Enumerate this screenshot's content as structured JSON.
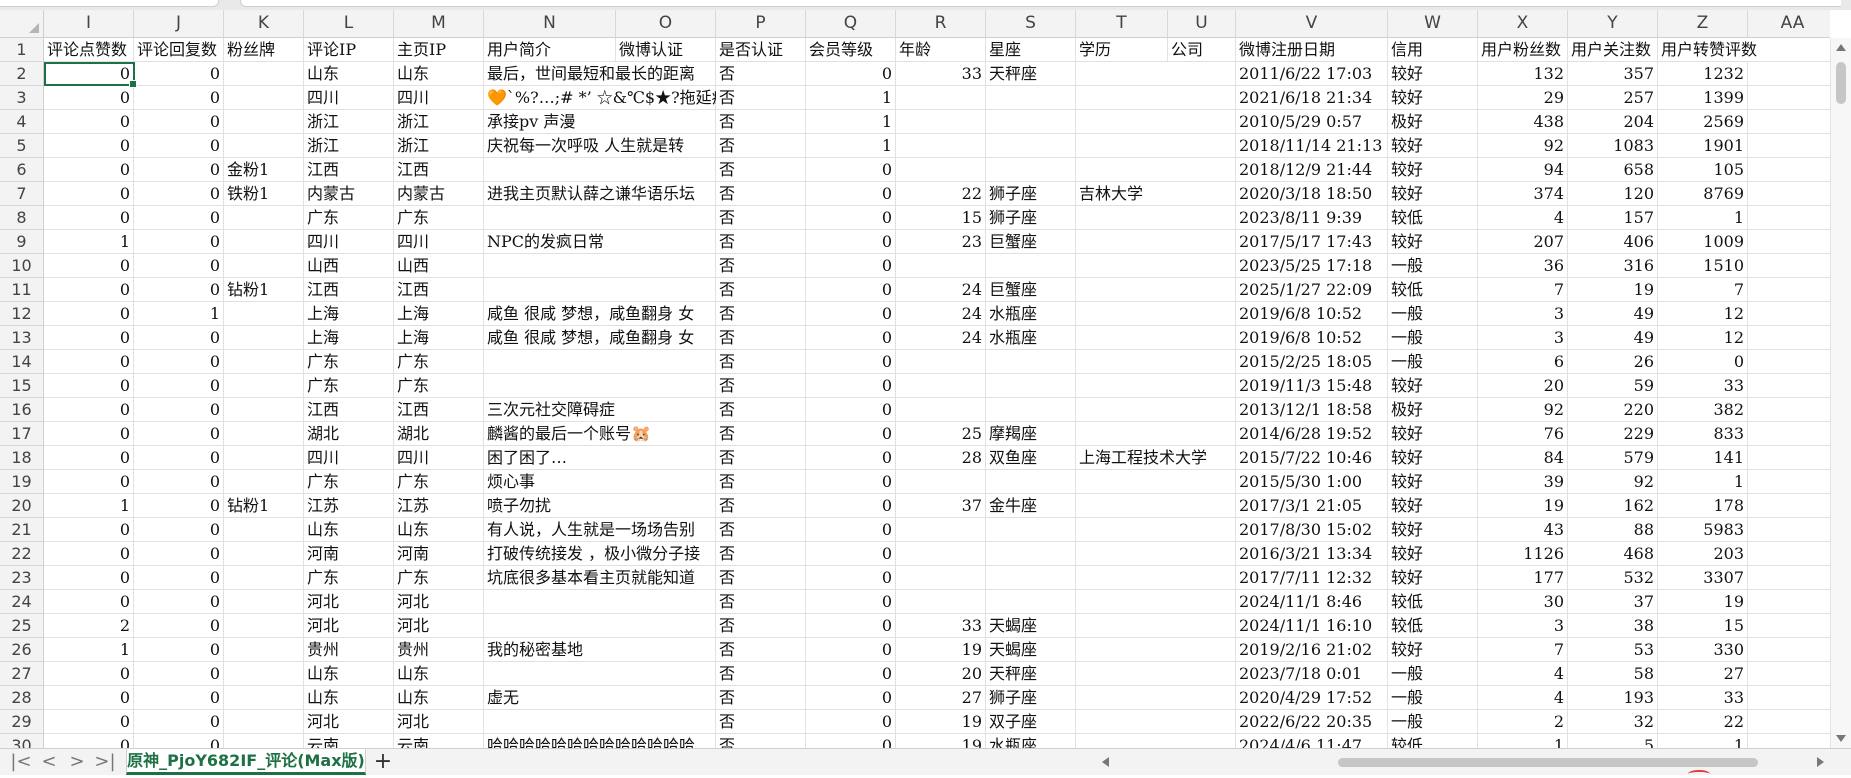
{
  "columns": [
    "I",
    "J",
    "K",
    "L",
    "M",
    "N",
    "O",
    "P",
    "Q",
    "R",
    "S",
    "T",
    "U",
    "V",
    "W",
    "X",
    "Y",
    "Z",
    "AA"
  ],
  "row_numbers": [
    1,
    2,
    3,
    4,
    5,
    6,
    7,
    8,
    9,
    10,
    11,
    12,
    13,
    14,
    15,
    16,
    17,
    18,
    19,
    20,
    21,
    22,
    23,
    24,
    25,
    26,
    27,
    28,
    29,
    30
  ],
  "header_row": [
    "评论点赞数",
    "评论回复数",
    "粉丝牌",
    "评论IP",
    "主页IP",
    "用户简介",
    "微博认证",
    "是否认证",
    "会员等级",
    "年龄",
    "星座",
    "学历",
    "公司",
    "微博注册日期",
    "信用",
    "用户粉丝数",
    "用户关注数",
    "用户转赞评数",
    ""
  ],
  "rows": [
    [
      "0",
      "0",
      "",
      "山东",
      "山东",
      "最后，世间最短和最长的距离",
      "",
      "否",
      "0",
      "33",
      "天秤座",
      "",
      "",
      "2011/6/22 17:03",
      "较好",
      "132",
      "357",
      "1232",
      ""
    ],
    [
      "0",
      "0",
      "",
      "四川",
      "四川",
      "🧡`%?…;# *’ ☆&℃$★?拖延症",
      "",
      "否",
      "1",
      "",
      "",
      "",
      "",
      "2021/6/18 21:34",
      "较好",
      "29",
      "257",
      "1399",
      ""
    ],
    [
      "0",
      "0",
      "",
      "浙江",
      "浙江",
      "承接pv 声漫",
      "",
      "否",
      "1",
      "",
      "",
      "",
      "",
      "2010/5/29 0:57",
      "极好",
      "438",
      "204",
      "2569",
      ""
    ],
    [
      "0",
      "0",
      "",
      "浙江",
      "浙江",
      "庆祝每一次呼吸 人生就是转",
      "",
      "否",
      "1",
      "",
      "",
      "",
      "",
      "2018/11/14 21:13",
      "较好",
      "92",
      "1083",
      "1901",
      ""
    ],
    [
      "0",
      "0",
      "金粉1",
      "江西",
      "江西",
      "",
      "",
      "否",
      "0",
      "",
      "",
      "",
      "",
      "2018/12/9 21:44",
      "较好",
      "94",
      "658",
      "105",
      ""
    ],
    [
      "0",
      "0",
      "铁粉1",
      "内蒙古",
      "内蒙古",
      "进我主页默认薛之谦华语乐坛",
      "",
      "否",
      "0",
      "22",
      "狮子座",
      "吉林大学",
      "",
      "2020/3/18 18:50",
      "较好",
      "374",
      "120",
      "8769",
      ""
    ],
    [
      "0",
      "0",
      "",
      "广东",
      "广东",
      "",
      "",
      "否",
      "0",
      "15",
      "狮子座",
      "",
      "",
      "2023/8/11 9:39",
      "较低",
      "4",
      "157",
      "1",
      ""
    ],
    [
      "1",
      "0",
      "",
      "四川",
      "四川",
      "NPC的发疯日常",
      "",
      "否",
      "0",
      "23",
      "巨蟹座",
      "",
      "",
      "2017/5/17 17:43",
      "较好",
      "207",
      "406",
      "1009",
      ""
    ],
    [
      "0",
      "0",
      "",
      "山西",
      "山西",
      "",
      "",
      "否",
      "0",
      "",
      "",
      "",
      "",
      "2023/5/25 17:18",
      "一般",
      "36",
      "316",
      "1510",
      ""
    ],
    [
      "0",
      "0",
      "钻粉1",
      "江西",
      "江西",
      "",
      "",
      "否",
      "0",
      "24",
      "巨蟹座",
      "",
      "",
      "2025/1/27 22:09",
      "较低",
      "7",
      "19",
      "7",
      ""
    ],
    [
      "0",
      "1",
      "",
      "上海",
      "上海",
      "咸鱼 很咸 梦想，咸鱼翻身 女",
      "",
      "否",
      "0",
      "24",
      "水瓶座",
      "",
      "",
      "2019/6/8 10:52",
      "一般",
      "3",
      "49",
      "12",
      ""
    ],
    [
      "0",
      "0",
      "",
      "上海",
      "上海",
      "咸鱼 很咸 梦想，咸鱼翻身 女",
      "",
      "否",
      "0",
      "24",
      "水瓶座",
      "",
      "",
      "2019/6/8 10:52",
      "一般",
      "3",
      "49",
      "12",
      ""
    ],
    [
      "0",
      "0",
      "",
      "广东",
      "广东",
      "",
      "",
      "否",
      "0",
      "",
      "",
      "",
      "",
      "2015/2/25 18:05",
      "一般",
      "6",
      "26",
      "0",
      ""
    ],
    [
      "0",
      "0",
      "",
      "广东",
      "广东",
      "",
      "",
      "否",
      "0",
      "",
      "",
      "",
      "",
      "2019/11/3 15:48",
      "较好",
      "20",
      "59",
      "33",
      ""
    ],
    [
      "0",
      "0",
      "",
      "江西",
      "江西",
      "三次元社交障碍症",
      "",
      "否",
      "0",
      "",
      "",
      "",
      "",
      "2013/12/1 18:58",
      "极好",
      "92",
      "220",
      "382",
      ""
    ],
    [
      "0",
      "0",
      "",
      "湖北",
      "湖北",
      "麟酱的最后一个账号🐹",
      "",
      "否",
      "0",
      "25",
      "摩羯座",
      "",
      "",
      "2014/6/28 19:52",
      "较好",
      "76",
      "229",
      "833",
      ""
    ],
    [
      "0",
      "0",
      "",
      "四川",
      "四川",
      "困了困了…",
      "",
      "否",
      "0",
      "28",
      "双鱼座",
      "上海工程技术大学",
      "",
      "2015/7/22 10:46",
      "较好",
      "84",
      "579",
      "141",
      ""
    ],
    [
      "0",
      "0",
      "",
      "广东",
      "广东",
      "烦心事",
      "",
      "否",
      "0",
      "",
      "",
      "",
      "",
      "2015/5/30 1:00",
      "较好",
      "39",
      "92",
      "1",
      ""
    ],
    [
      "1",
      "0",
      "钻粉1",
      "江苏",
      "江苏",
      "喷子勿扰",
      "",
      "否",
      "0",
      "37",
      "金牛座",
      "",
      "",
      "2017/3/1 21:05",
      "较好",
      "19",
      "162",
      "178",
      ""
    ],
    [
      "0",
      "0",
      "",
      "山东",
      "山东",
      "有人说，人生就是一场场告别",
      "",
      "否",
      "0",
      "",
      "",
      "",
      "",
      "2017/8/30 15:02",
      "较好",
      "43",
      "88",
      "5983",
      ""
    ],
    [
      "0",
      "0",
      "",
      "河南",
      "河南",
      "打破传统接发 ，极小微分子接",
      "",
      "否",
      "0",
      "",
      "",
      "",
      "",
      "2016/3/21 13:34",
      "较好",
      "1126",
      "468",
      "203",
      ""
    ],
    [
      "0",
      "0",
      "",
      "广东",
      "广东",
      "坑底很多基本看主页就能知道",
      "",
      "否",
      "0",
      "",
      "",
      "",
      "",
      "2017/7/11 12:32",
      "较好",
      "177",
      "532",
      "3307",
      ""
    ],
    [
      "0",
      "0",
      "",
      "河北",
      "河北",
      "",
      "",
      "否",
      "0",
      "",
      "",
      "",
      "",
      "2024/11/1 8:46",
      "较低",
      "30",
      "37",
      "19",
      ""
    ],
    [
      "2",
      "0",
      "",
      "河北",
      "河北",
      "",
      "",
      "否",
      "0",
      "33",
      "天蝎座",
      "",
      "",
      "2024/11/1 16:10",
      "较低",
      "3",
      "38",
      "15",
      ""
    ],
    [
      "1",
      "0",
      "",
      "贵州",
      "贵州",
      "我的秘密基地",
      "",
      "否",
      "0",
      "19",
      "天蝎座",
      "",
      "",
      "2019/2/16 21:02",
      "较好",
      "7",
      "53",
      "330",
      ""
    ],
    [
      "0",
      "0",
      "",
      "山东",
      "山东",
      "",
      "",
      "否",
      "0",
      "20",
      "天秤座",
      "",
      "",
      "2023/7/18 0:01",
      "一般",
      "4",
      "58",
      "27",
      ""
    ],
    [
      "0",
      "0",
      "",
      "山东",
      "山东",
      "虚无",
      "",
      "否",
      "0",
      "27",
      "狮子座",
      "",
      "",
      "2020/4/29 17:52",
      "一般",
      "4",
      "193",
      "33",
      ""
    ],
    [
      "0",
      "0",
      "",
      "河北",
      "河北",
      "",
      "",
      "否",
      "0",
      "19",
      "双子座",
      "",
      "",
      "2022/6/22 20:35",
      "一般",
      "2",
      "32",
      "22",
      ""
    ],
    [
      "0",
      "0",
      "",
      "云南",
      "云南",
      "哈哈哈哈哈哈哈哈哈哈哈哈哈",
      "",
      "否",
      "0",
      "19",
      "水瓶座",
      "",
      "",
      "2024/4/6 11:47",
      "较低",
      "1",
      "5",
      "1",
      ""
    ]
  ],
  "sheet_tab_label": "原神_PjoY682IF_评论(Max版)",
  "add_sheet_label": "+",
  "nav_labels": [
    "|<",
    "<",
    ">",
    ">|"
  ],
  "accent_color": "#1e7145"
}
